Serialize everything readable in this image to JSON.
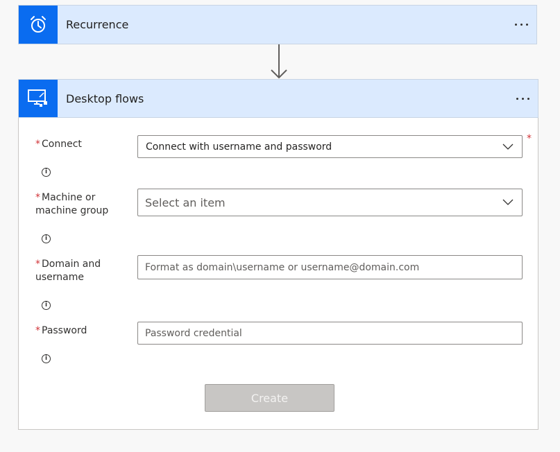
{
  "recurrence": {
    "title": "Recurrence",
    "icon": "alarm-clock-icon",
    "menu_icon": "more-icon"
  },
  "desktop_flows": {
    "title": "Desktop flows",
    "icon": "desktop-flow-icon",
    "menu_icon": "more-icon",
    "fields": {
      "connect": {
        "label": "Connect",
        "required_mark": "*",
        "value": "Connect with username and password"
      },
      "machine": {
        "label_line1": "Machine or",
        "label_line2": "machine group",
        "required_mark": "*",
        "placeholder": "Select an item"
      },
      "domain": {
        "label_line1": "Domain and",
        "label_line2": "username",
        "required_mark": "*",
        "placeholder": "Format as domain\\username or username@domain.com"
      },
      "password": {
        "label": "Password",
        "required_mark": "*",
        "placeholder": "Password credential"
      }
    },
    "info_glyph": "i",
    "create_button": "Create"
  },
  "colors": {
    "accent": "#0a6cf0",
    "header_bg": "#dbeafe",
    "required": "#d13438",
    "disabled_button": "#c8c6c4"
  }
}
